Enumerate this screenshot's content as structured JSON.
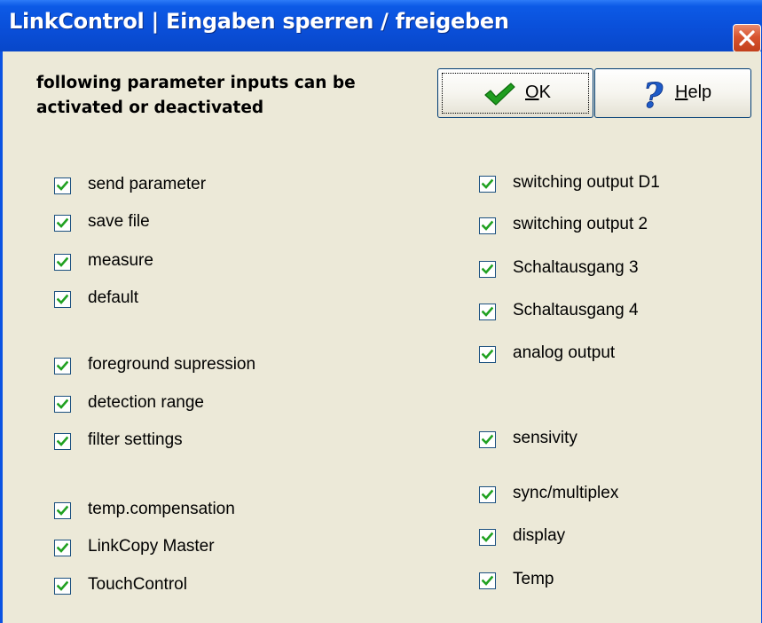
{
  "window": {
    "title": "LinkControl | Eingaben sperren / freigeben",
    "close_icon": "close-icon"
  },
  "header": {
    "line1": "following parameter inputs can be",
    "line2": "activated or deactivated"
  },
  "buttons": {
    "ok": {
      "mnemonic": "O",
      "rest": "K",
      "icon": "checkmark-icon"
    },
    "help": {
      "mnemonic": "H",
      "rest": "elp",
      "icon": "question-icon"
    }
  },
  "left_options": [
    {
      "label": "send parameter",
      "checked": true
    },
    {
      "label": "save file",
      "checked": true
    },
    {
      "label": "measure",
      "checked": true
    },
    {
      "label": "default",
      "checked": true
    },
    {
      "label": "foreground supression",
      "checked": true
    },
    {
      "label": "detection range",
      "checked": true
    },
    {
      "label": "filter settings",
      "checked": true
    },
    {
      "label": "temp.compensation",
      "checked": true
    },
    {
      "label": "LinkCopy Master",
      "checked": true
    },
    {
      "label": "TouchControl",
      "checked": true
    }
  ],
  "right_options": [
    {
      "label": "switching output D1",
      "checked": true
    },
    {
      "label": "switching output 2",
      "checked": true
    },
    {
      "label": "Schaltausgang 3",
      "checked": true
    },
    {
      "label": "Schaltausgang 4",
      "checked": true
    },
    {
      "label": "analog output",
      "checked": true
    },
    {
      "label": "sensivity",
      "checked": true
    },
    {
      "label": "sync/multiplex",
      "checked": true
    },
    {
      "label": "display",
      "checked": true
    },
    {
      "label": "Temp",
      "checked": true
    }
  ],
  "colors": {
    "title_bar": "#0a4fd9",
    "dialog_face": "#ece9d8",
    "checkbox_border": "#1c5180",
    "check_mark": "#21a121",
    "close_button": "#d8542f"
  }
}
